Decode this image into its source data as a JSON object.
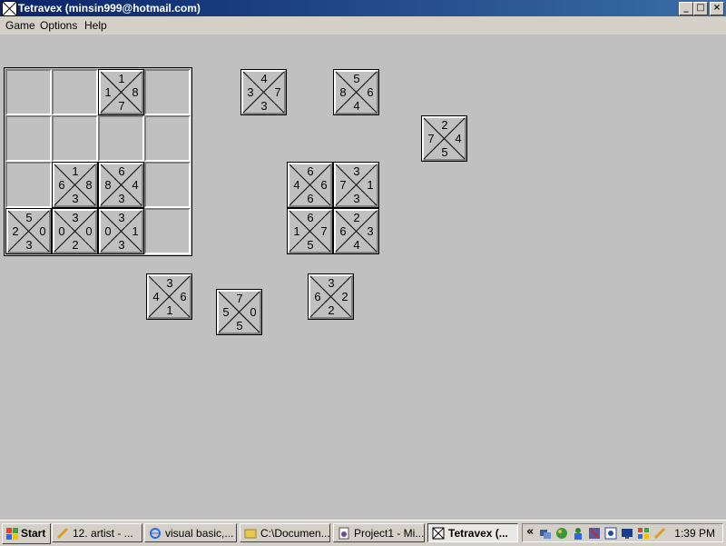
{
  "window": {
    "title": "Tetravex  (minsin999@hotmail.com)",
    "minimize": "_",
    "maximize": "□",
    "close": "×"
  },
  "menu": [
    {
      "label": "Game"
    },
    {
      "label": "Options"
    },
    {
      "label": "Help"
    }
  ],
  "board": {
    "rows": 4,
    "cols": 4,
    "placed": [
      {
        "row": 0,
        "col": 2,
        "top": "1",
        "right": "8",
        "bottom": "7",
        "left": "1"
      },
      {
        "row": 2,
        "col": 1,
        "top": "1",
        "right": "8",
        "bottom": "3",
        "left": "6"
      },
      {
        "row": 2,
        "col": 2,
        "top": "6",
        "right": "4",
        "bottom": "3",
        "left": "8"
      },
      {
        "row": 3,
        "col": 0,
        "top": "5",
        "right": "0",
        "bottom": "3",
        "left": "2"
      },
      {
        "row": 3,
        "col": 1,
        "top": "3",
        "right": "0",
        "bottom": "2",
        "left": "0"
      },
      {
        "row": 3,
        "col": 2,
        "top": "3",
        "right": "1",
        "bottom": "3",
        "left": "0"
      }
    ]
  },
  "loose_tiles": [
    {
      "top": "4",
      "right": "7",
      "bottom": "3",
      "left": "3"
    },
    {
      "top": "5",
      "right": "6",
      "bottom": "4",
      "left": "8"
    },
    {
      "top": "2",
      "right": "4",
      "bottom": "5",
      "left": "7"
    },
    {
      "top": "6",
      "right": "6",
      "bottom": "6",
      "left": "4"
    },
    {
      "top": "3",
      "right": "1",
      "bottom": "3",
      "left": "7"
    },
    {
      "top": "6",
      "right": "7",
      "bottom": "5",
      "left": "1"
    },
    {
      "top": "2",
      "right": "3",
      "bottom": "4",
      "left": "6"
    },
    {
      "top": "3",
      "right": "6",
      "bottom": "1",
      "left": "4"
    },
    {
      "top": "7",
      "right": "0",
      "bottom": "5",
      "left": "5"
    },
    {
      "top": "3",
      "right": "2",
      "bottom": "2",
      "left": "6"
    }
  ],
  "taskbar": {
    "start": "Start",
    "tasks": [
      {
        "label": "12. artist - ...",
        "icon": "pencil-icon",
        "active": false
      },
      {
        "label": "visual basic,...",
        "icon": "ie-icon",
        "active": false
      },
      {
        "label": "C:\\Documen...",
        "icon": "folder-icon",
        "active": false
      },
      {
        "label": "Project1 - Mi...",
        "icon": "vb-icon",
        "active": false
      },
      {
        "label": "Tetravex  (...",
        "icon": "tetravex-icon",
        "active": true
      }
    ],
    "tray_chevron": "«",
    "clock": "1:39 PM"
  }
}
